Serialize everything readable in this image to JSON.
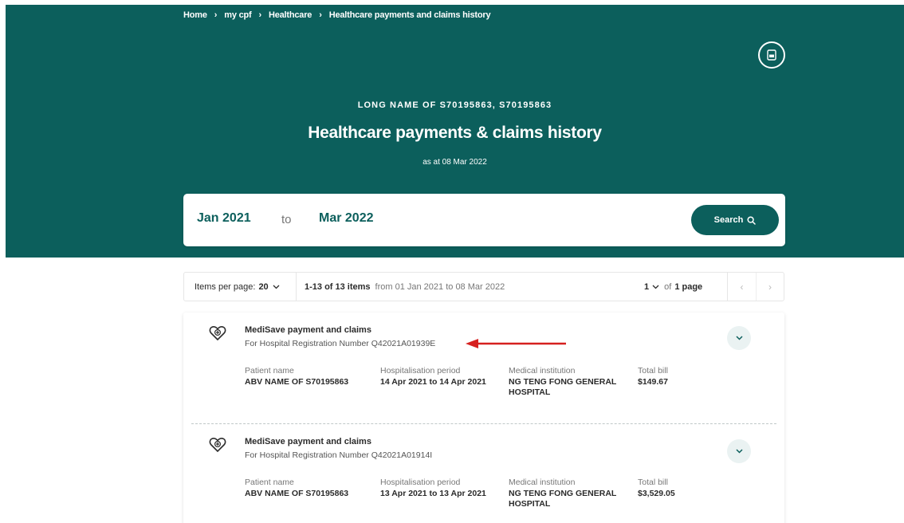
{
  "breadcrumb": [
    "Home",
    "my cpf",
    "Healthcare",
    "Healthcare payments and claims history"
  ],
  "breadcrumb_separator": "›",
  "header": {
    "member_name": "LONG NAME OF S70195863, S70195863",
    "title": "Healthcare payments & claims history",
    "as_at": "as at 08 Mar 2022",
    "pdf_icon": "pdf-download-icon"
  },
  "search": {
    "from": "Jan 2021",
    "to_word": "to",
    "to": "Mar 2022",
    "button_label": "Search"
  },
  "toolbar": {
    "items_per_page_label": "Items per page:",
    "items_per_page_value": "20",
    "count_label": "1-13 of 13 items",
    "range_label": "from 01 Jan 2021 to 08 Mar 2022",
    "current_page": "1",
    "of_label": "of",
    "total_pages": "1 page",
    "prev_icon": "‹",
    "next_icon": "›"
  },
  "claims": [
    {
      "title": "MediSave payment and claims",
      "subtitle": "For Hospital Registration Number Q42021A01939E",
      "patient_label": "Patient name",
      "patient": "ABV NAME OF S70195863",
      "period_label": "Hospitalisation period",
      "period": "14 Apr 2021 to 14 Apr 2021",
      "institution_label": "Medical institution",
      "institution_line1": "NG TENG FONG GENERAL",
      "institution_line2": "HOSPITAL",
      "bill_label": "Total bill",
      "bill": "$149.67"
    },
    {
      "title": "MediSave payment and claims",
      "subtitle": "For Hospital Registration Number Q42021A01914I",
      "patient_label": "Patient name",
      "patient": "ABV NAME OF S70195863",
      "period_label": "Hospitalisation period",
      "period": "13 Apr 2021 to 13 Apr 2021",
      "institution_label": "Medical institution",
      "institution_line1": "NG TENG FONG GENERAL",
      "institution_line2": "HOSPITAL",
      "bill_label": "Total bill",
      "bill": "$3,529.05"
    }
  ],
  "colors": {
    "brand_teal": "#0c5f5c",
    "annotation_arrow": "#d6201f"
  }
}
